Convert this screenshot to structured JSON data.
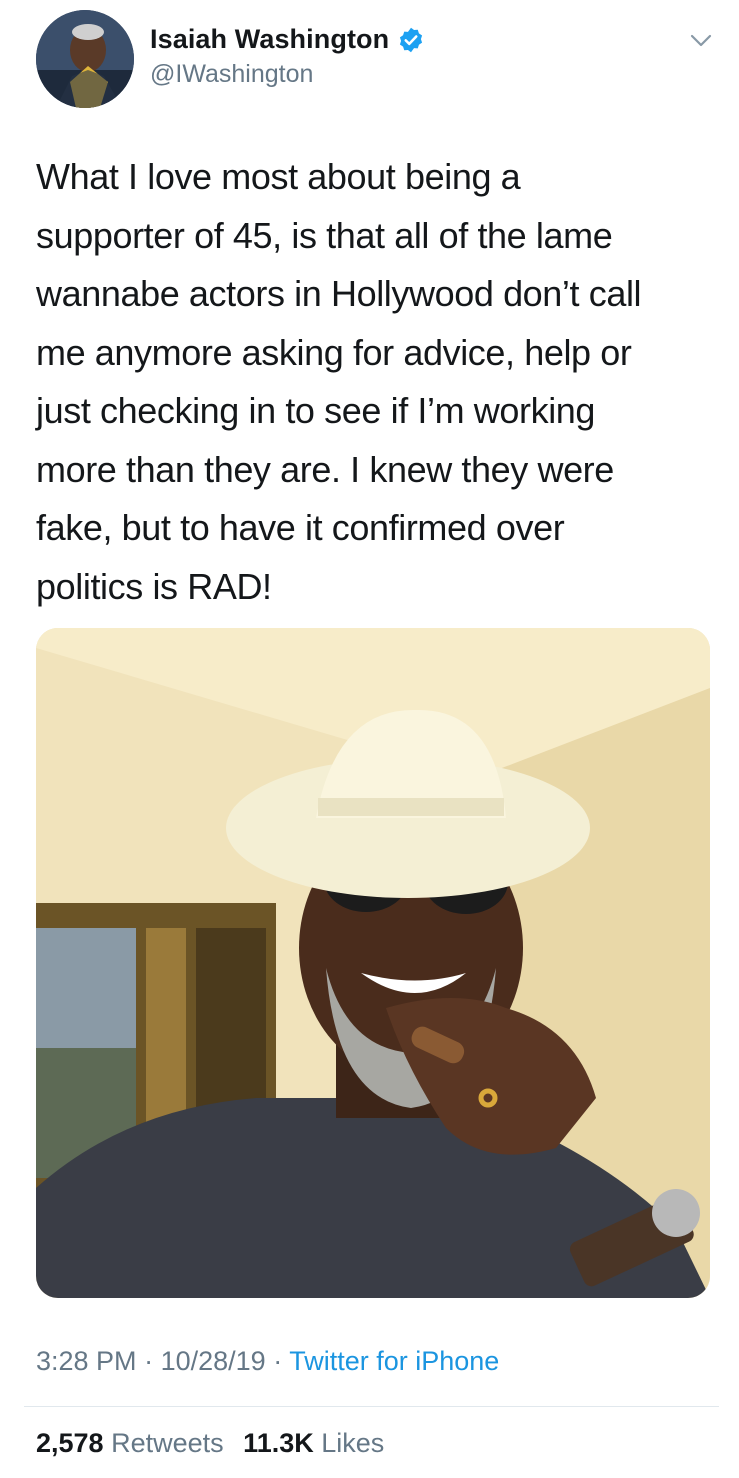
{
  "user": {
    "display_name": "Isaiah Washington",
    "handle": "@IWashington",
    "verified": true
  },
  "tweet": {
    "text": "What I love most about being a\nsupporter of 45, is that all of the lame\nwannabe actors in Hollywood don’t call\nme anymore asking for advice, help or\njust checking in to see if I’m working\nmore than they are. I knew they were\nfake, but to have it confirmed over\npolitics is RAD!",
    "time": "3:28 PM",
    "date": "10/28/19",
    "separator": "·",
    "source": "Twitter for iPhone"
  },
  "stats": {
    "retweets_count": "2,578",
    "retweets_label": "Retweets",
    "likes_count": "11.3K",
    "likes_label": "Likes"
  },
  "colors": {
    "verified_blue": "#1da1f2",
    "link_blue": "#1b95e0",
    "secondary_gray": "#657786"
  },
  "icons": {
    "verified": "verified-badge-icon",
    "menu": "chevron-down-icon"
  }
}
